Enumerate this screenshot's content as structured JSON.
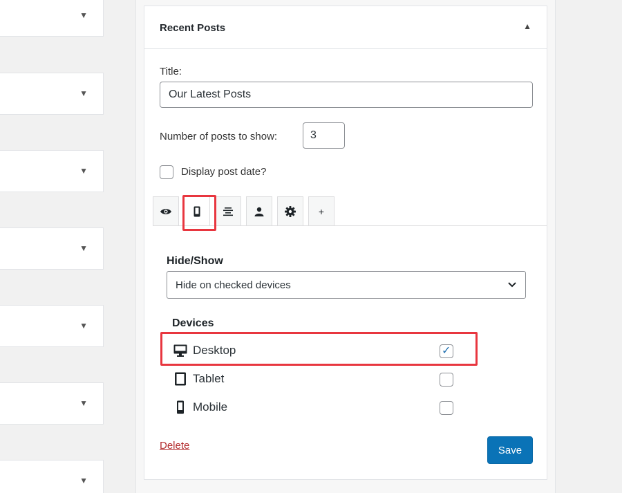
{
  "left_widgets": [
    {
      "caret": "▼"
    },
    {
      "caret": "▼"
    },
    {
      "caret": "▼"
    },
    {
      "caret": "▼"
    },
    {
      "caret": "▼"
    },
    {
      "caret": "▼"
    },
    {
      "caret": "▼"
    }
  ],
  "widget": {
    "title": "Recent Posts",
    "toggle": "▲",
    "title_label": "Title:",
    "title_value": "Our Latest Posts",
    "number_label": "Number of posts to show:",
    "number_value": "3",
    "display_date_label": "Display post date?",
    "display_date_checked": false
  },
  "tabs": [
    {
      "icon": "eye-icon"
    },
    {
      "icon": "mobile-icon",
      "active": true
    },
    {
      "icon": "align-center-icon"
    },
    {
      "icon": "user-icon"
    },
    {
      "icon": "gear-icon"
    },
    {
      "icon": "plus-icon",
      "text": "+"
    }
  ],
  "visibility": {
    "hide_show_label": "Hide/Show",
    "select_value": "Hide on checked devices",
    "devices_label": "Devices",
    "devices": [
      {
        "label": "Desktop",
        "checked": true,
        "icon": "desktop-icon"
      },
      {
        "label": "Tablet",
        "checked": false,
        "icon": "tablet-icon"
      },
      {
        "label": "Mobile",
        "checked": false,
        "icon": "mobile-icon"
      }
    ],
    "checkmark": "✓"
  },
  "footer": {
    "delete_label": "Delete",
    "save_label": "Save"
  },
  "colors": {
    "highlight": "#e8363f",
    "primary_button": "#0a73b7",
    "delete_link": "#b32d2e"
  }
}
